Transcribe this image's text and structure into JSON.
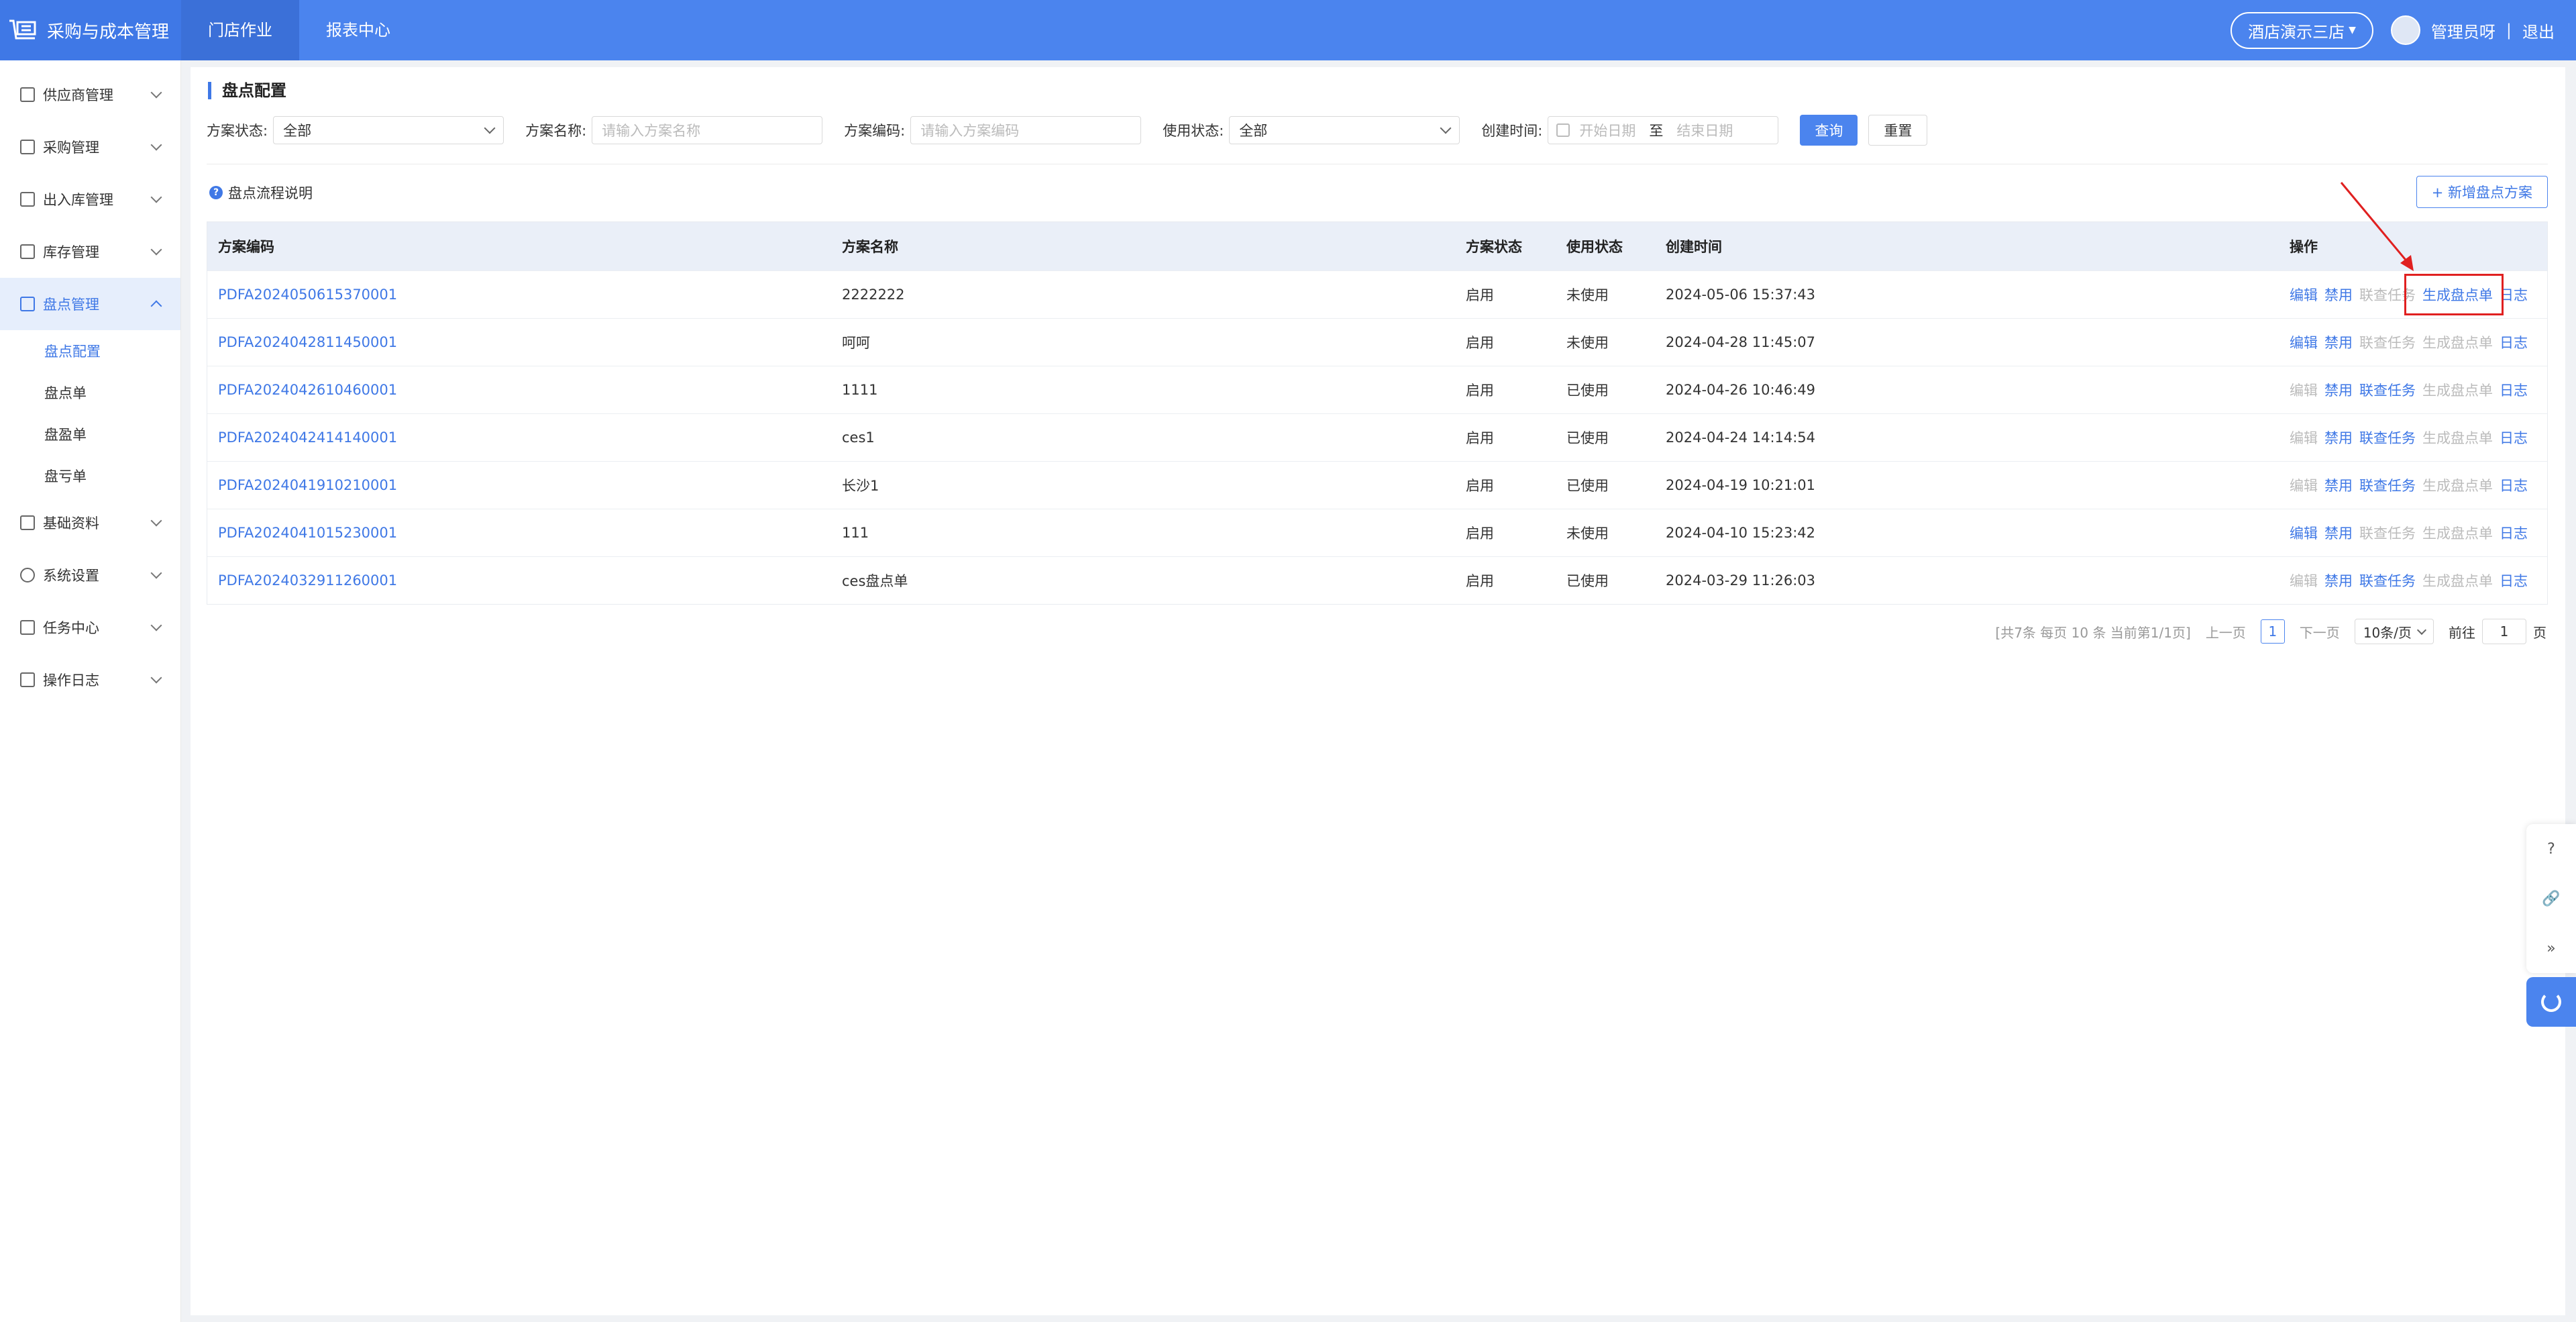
{
  "app": {
    "title": "采购与成本管理"
  },
  "topnav": [
    {
      "label": "门店作业"
    },
    {
      "label": "报表中心"
    }
  ],
  "topright": {
    "store": "酒店演示三店",
    "user": "管理员呀",
    "divider": "|",
    "logout": "退出"
  },
  "sidebar": {
    "items": [
      {
        "label": "供应商管理"
      },
      {
        "label": "采购管理"
      },
      {
        "label": "出入库管理"
      },
      {
        "label": "库存管理"
      },
      {
        "label": "盘点管理"
      },
      {
        "label": "基础资料"
      },
      {
        "label": "系统设置"
      },
      {
        "label": "任务中心"
      },
      {
        "label": "操作日志"
      }
    ],
    "sub": [
      {
        "label": "盘点配置"
      },
      {
        "label": "盘点单"
      },
      {
        "label": "盘盈单"
      },
      {
        "label": "盘亏单"
      }
    ]
  },
  "page": {
    "title": "盘点配置"
  },
  "filters": {
    "status_label": "方案状态:",
    "status_value": "全部",
    "name_label": "方案名称:",
    "name_placeholder": "请输入方案名称",
    "code_label": "方案编码:",
    "code_placeholder": "请输入方案编码",
    "use_label": "使用状态:",
    "use_value": "全部",
    "time_label": "创建时间:",
    "start_placeholder": "开始日期",
    "to": "至",
    "end_placeholder": "结束日期",
    "query": "查询",
    "reset": "重置"
  },
  "help": {
    "icon": "?",
    "label": "盘点流程说明"
  },
  "add_button": "+ 新增盘点方案",
  "table": {
    "headers": [
      "方案编码",
      "方案名称",
      "方案状态",
      "使用状态",
      "创建时间",
      "操作"
    ],
    "ops": {
      "edit": "编辑",
      "disable": "禁用",
      "linked": "联查任务",
      "gen": "生成盘点单",
      "log": "日志"
    },
    "rows": [
      [
        "PDFA2024050615370001",
        "2222222",
        "启用",
        "未使用",
        "2024-05-06 15:37:43"
      ],
      [
        "PDFA2024042811450001",
        "呵呵",
        "启用",
        "未使用",
        "2024-04-28 11:45:07"
      ],
      [
        "PDFA2024042610460001",
        "1111",
        "启用",
        "已使用",
        "2024-04-26 10:46:49"
      ],
      [
        "PDFA2024042414140001",
        "ces1",
        "启用",
        "已使用",
        "2024-04-24 14:14:54"
      ],
      [
        "PDFA2024041910210001",
        "长沙1",
        "启用",
        "已使用",
        "2024-04-19 10:21:01"
      ],
      [
        "PDFA2024041015230001",
        "111",
        "启用",
        "未使用",
        "2024-04-10 15:23:42"
      ],
      [
        "PDFA2024032911260001",
        "ces盘点单",
        "启用",
        "已使用",
        "2024-03-29 11:26:03"
      ]
    ]
  },
  "pager": {
    "summary": "[共7条 每页 10 条 当前第1/1页]",
    "prev": "上一页",
    "current": "1",
    "next": "下一页",
    "size": "10条/页",
    "goto": "前往",
    "goto_value": "1",
    "page_unit": "页"
  },
  "floating": {
    "help_icon": "?",
    "link_icon": "🔗",
    "collapse_icon": "»"
  },
  "colors": {
    "primary": "#4b84ee",
    "annotation": "#e02020"
  }
}
